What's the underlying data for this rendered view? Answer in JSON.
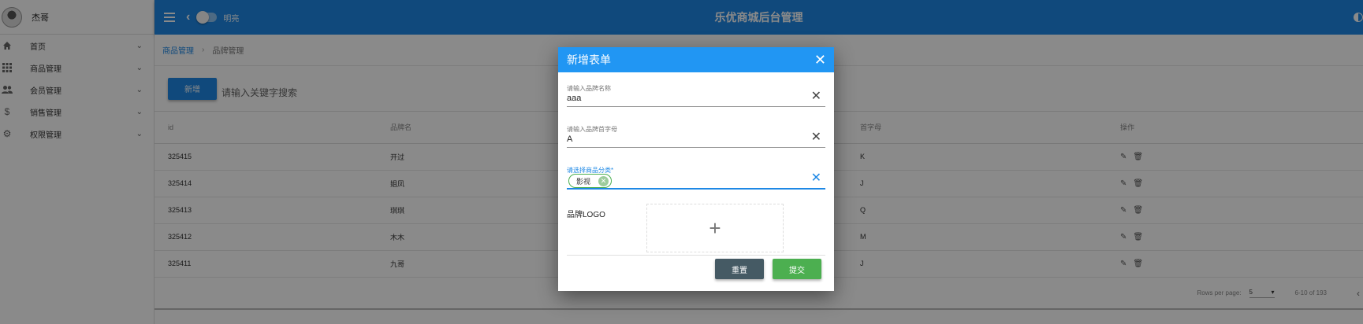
{
  "user": {
    "name": "杰哥"
  },
  "sidebar": {
    "items": [
      {
        "label": "首页",
        "icon": "home-icon"
      },
      {
        "label": "商品管理",
        "icon": "apps-icon"
      },
      {
        "label": "会员管理",
        "icon": "people-icon"
      },
      {
        "label": "销售管理",
        "icon": "dollar-icon"
      },
      {
        "label": "权限管理",
        "icon": "gear-icon"
      }
    ]
  },
  "topbar": {
    "toggle_label": "明亮",
    "title": "乐优商城后台管理"
  },
  "breadcrumb": {
    "parent": "商品管理",
    "separator": "›",
    "current": "品牌管理"
  },
  "toolbar": {
    "add_label": "新增",
    "search_placeholder": "请输入关键字搜索"
  },
  "table": {
    "headers": {
      "id": "id",
      "name": "品牌名",
      "letter": "首字母",
      "actions": "操作"
    },
    "rows": [
      {
        "id": "325415",
        "name": "开过",
        "letter": "K"
      },
      {
        "id": "325414",
        "name": "姐凤",
        "letter": "J"
      },
      {
        "id": "325413",
        "name": "琪琪",
        "letter": "Q"
      },
      {
        "id": "325412",
        "name": "木木",
        "letter": "M"
      },
      {
        "id": "325411",
        "name": "九哥",
        "letter": "J"
      }
    ]
  },
  "pagination": {
    "rows_label": "Rows per page:",
    "rows_value": "5",
    "range": "6-10 of 193"
  },
  "dialog": {
    "title": "新增表单",
    "name_field": {
      "label": "请输入品牌名称",
      "value": "aaa"
    },
    "letter_field": {
      "label": "请输入品牌首字母",
      "value": "A"
    },
    "category_field": {
      "label": "请选择商品分类*",
      "chip": "影视"
    },
    "logo_label": "品牌LOGO",
    "reset_label": "重置",
    "submit_label": "提交"
  },
  "colors": {
    "primary": "#1e88e5",
    "header": "#2196f3",
    "success": "#4caf50",
    "reset": "#455a64"
  }
}
